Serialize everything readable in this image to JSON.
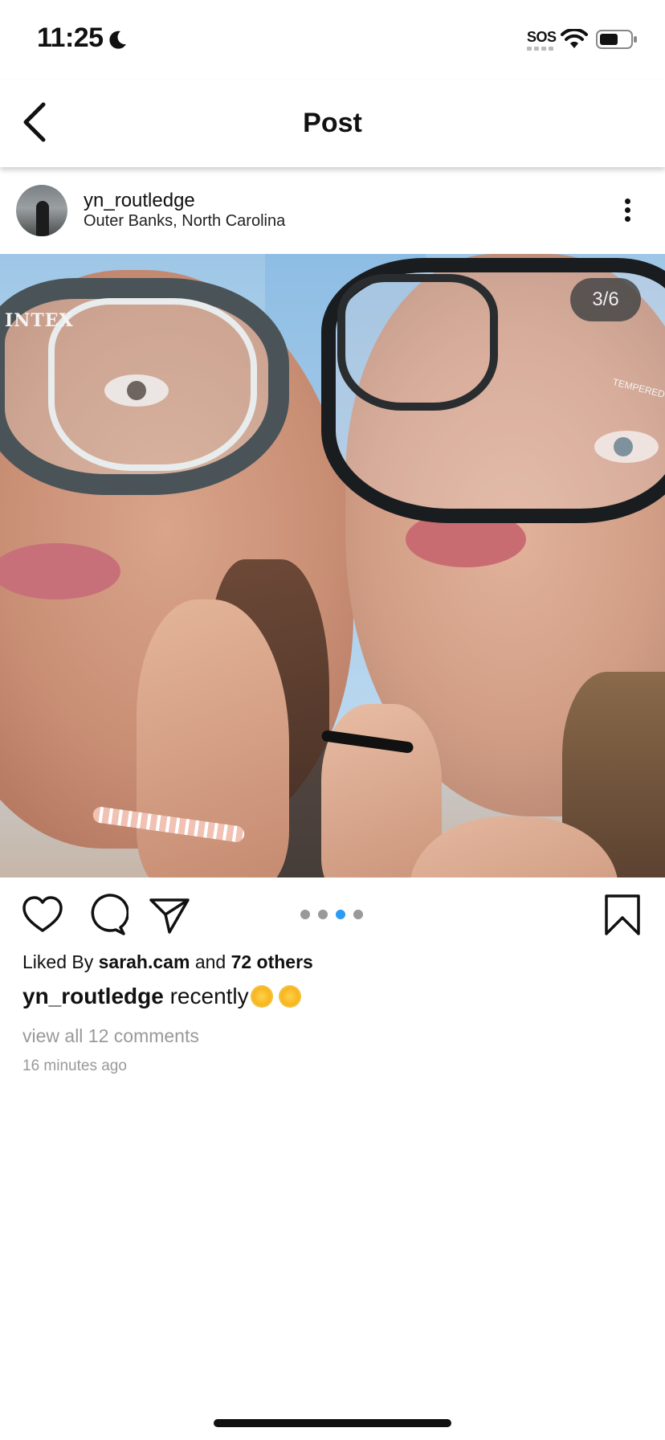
{
  "status_bar": {
    "time": "11:25",
    "carrier": "SOS",
    "moon_icon": "moon-icon",
    "wifi_icon": "wifi-icon",
    "battery_icon": "battery-icon"
  },
  "header": {
    "title": "Post",
    "back_icon": "chevron-left-icon"
  },
  "post": {
    "username": "yn_routledge",
    "location": "Outer Banks, North Carolina",
    "more_icon": "more-vertical-icon",
    "image_counter": "3/6",
    "mask_brand_left": "INTEX",
    "mask_brand_right": "TEMPERED",
    "carousel": {
      "total_dots": 4,
      "active_index": 2,
      "active_color": "#2b9bf4",
      "inactive_color": "#999999"
    }
  },
  "actions": {
    "like_icon": "heart-icon",
    "comment_icon": "comment-icon",
    "share_icon": "send-icon",
    "save_icon": "bookmark-icon"
  },
  "details": {
    "liked_by_prefix": "Liked By",
    "liked_by_user": "sarah.cam",
    "liked_by_and": "and",
    "liked_by_others": "72 others",
    "caption_username": "yn_routledge",
    "caption_text": "recently",
    "caption_emoji": [
      "sun-emoji",
      "sun-emoji"
    ],
    "view_comments": "view all 12 comments",
    "time_ago": "16 minutes ago"
  }
}
